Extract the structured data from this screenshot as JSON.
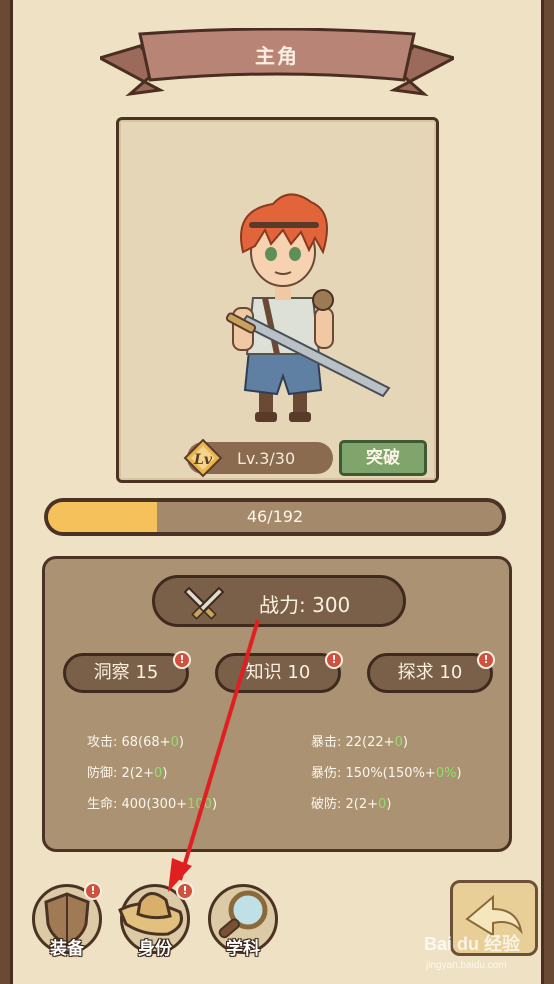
{
  "header": {
    "title": "主角"
  },
  "character": {
    "level_text": "Lv.3/30",
    "level_badge": "Lv",
    "breakthrough_label": "突破"
  },
  "exp": {
    "text": "46/192",
    "fraction": 0.24
  },
  "power": {
    "text": "战力: 300",
    "icon": "crossed-swords-icon"
  },
  "attributes": [
    {
      "label": "洞察 15",
      "alert": "!"
    },
    {
      "label": "知识 10",
      "alert": "!"
    },
    {
      "label": "探求 10",
      "alert": "!"
    }
  ],
  "stats": {
    "left": [
      {
        "base": "攻击: 68(68+",
        "bonus": "0",
        "end": ")"
      },
      {
        "base": "防御: 2(2+",
        "bonus": "0",
        "end": ")"
      },
      {
        "base": "生命: 400(300+",
        "bonus": "100",
        "end": ")"
      }
    ],
    "right": [
      {
        "base": "暴击: 22(22+",
        "bonus": "0",
        "end": ")"
      },
      {
        "base": "暴伤: 150%(150%+",
        "bonus": "0%",
        "end": ")"
      },
      {
        "base": "破防: 2(2+",
        "bonus": "0",
        "end": ")"
      }
    ]
  },
  "tabs": [
    {
      "label": "装备",
      "icon": "shield-icon",
      "alert": "!"
    },
    {
      "label": "身份",
      "icon": "hat-icon",
      "alert": "!"
    },
    {
      "label": "学科",
      "icon": "magnifier-icon"
    }
  ],
  "colors": {
    "parchment": "#efe2c4",
    "exp_fill": "#f5c15a",
    "breakthrough": "#7fa46c",
    "alert": "#d0513d",
    "bonus": "#8ee06a",
    "annotation_arrow": "#e02020"
  },
  "watermark": {
    "text": "Bai du 经验",
    "sub": "jingyan.baidu.com"
  }
}
